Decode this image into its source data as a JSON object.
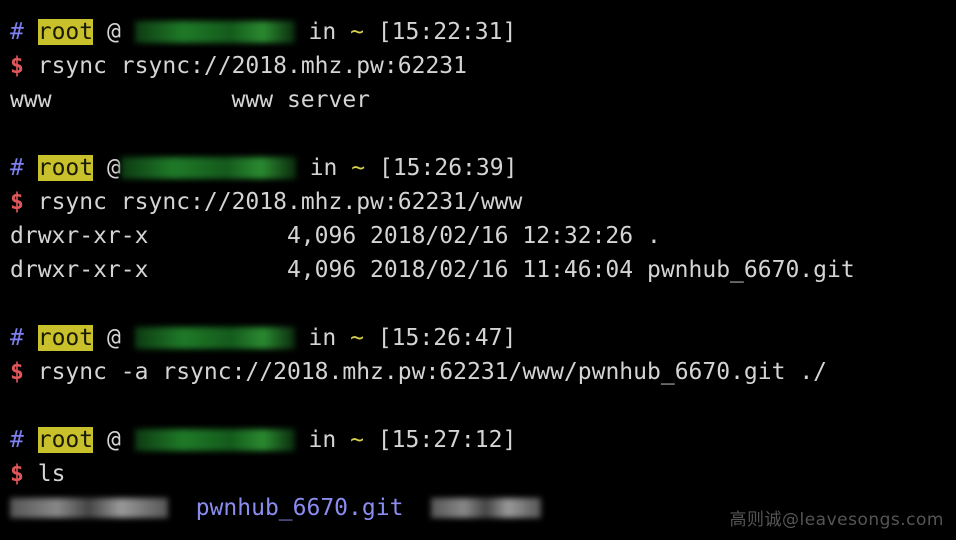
{
  "prompts": [
    {
      "hash": "#",
      "user": "root",
      "at": "@",
      "in": "in",
      "dir": "~",
      "time": "[15:22:31]"
    },
    {
      "hash": "#",
      "user": "root",
      "at": "@",
      "in": "in",
      "dir": "~",
      "time": "[15:26:39]"
    },
    {
      "hash": "#",
      "user": "root",
      "at": "@",
      "in": "in",
      "dir": "~",
      "time": "[15:26:47]"
    },
    {
      "hash": "#",
      "user": "root",
      "at": "@",
      "in": "in",
      "dir": "~",
      "time": "[15:27:12]"
    }
  ],
  "dollar": "$",
  "commands": [
    "rsync rsync://2018.mhz.pw:62231",
    "rsync rsync://2018.mhz.pw:62231/www",
    "rsync -a rsync://2018.mhz.pw:62231/www/pwnhub_6670.git ./",
    "ls"
  ],
  "output1": "www             www server",
  "output2": [
    "drwxr-xr-x          4,096 2018/02/16 12:32:26 .",
    "drwxr-xr-x          4,096 2018/02/16 11:46:04 pwnhub_6670.git"
  ],
  "ls_dir": "pwnhub_6670.git",
  "watermark": "高则诚@leavesongs.com",
  "colors": {
    "hash": "#7e80f2",
    "root_bg": "#c9c12b",
    "dollar": "#e0575a",
    "dir": "#8a8cf0"
  }
}
